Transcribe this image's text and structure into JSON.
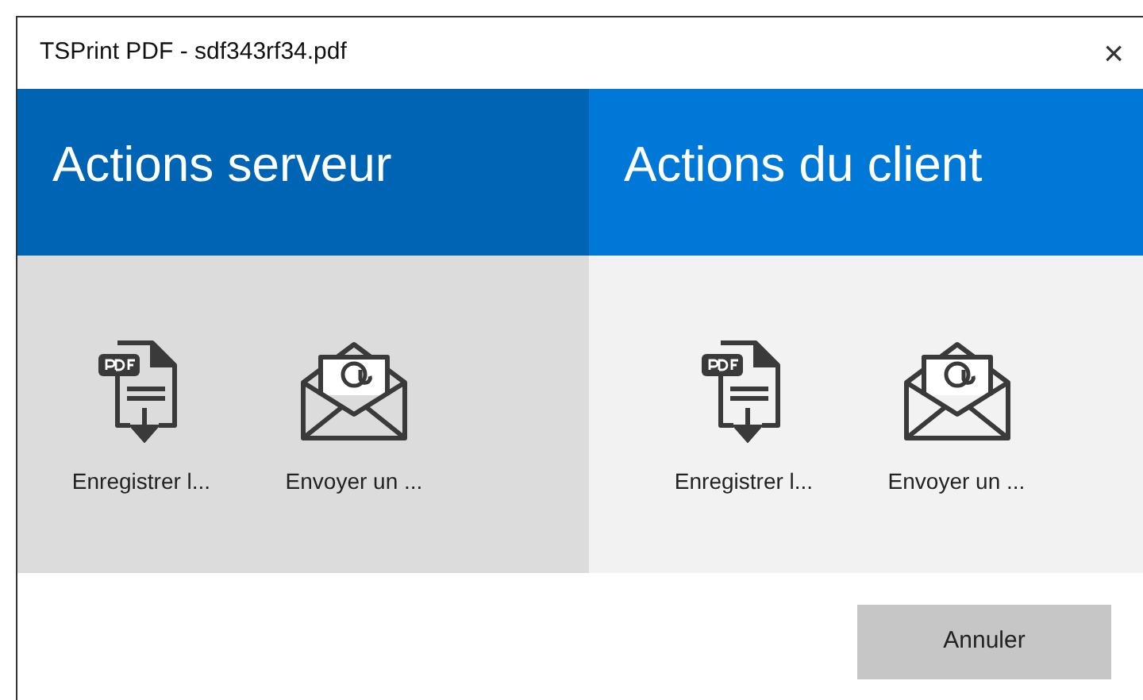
{
  "window": {
    "title": "TSPrint PDF - sdf343rf34.pdf",
    "close": "×"
  },
  "panels": [
    {
      "title": "Actions serveur",
      "selected": true,
      "actions": [
        {
          "kind": "pdf",
          "label": "Enregistrer l..."
        },
        {
          "kind": "email",
          "label": "Envoyer un ..."
        }
      ]
    },
    {
      "title": "Actions du client",
      "selected": false,
      "actions": [
        {
          "kind": "pdf",
          "label": "Enregistrer l..."
        },
        {
          "kind": "email",
          "label": "Envoyer un ..."
        }
      ]
    }
  ],
  "buttons": [
    "Annuler"
  ]
}
